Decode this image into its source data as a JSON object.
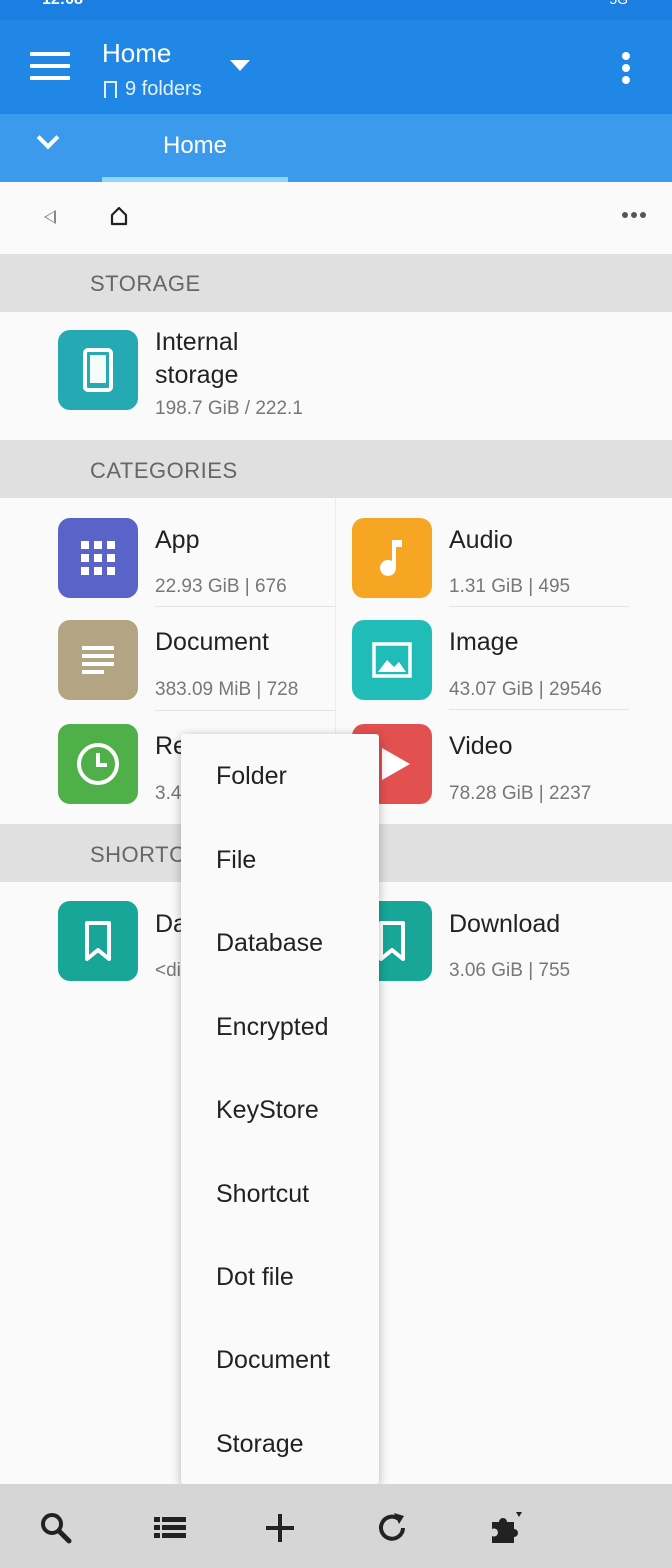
{
  "status_bar": {
    "time": "12:08",
    "right": "5G"
  },
  "app_bar": {
    "title": "Home",
    "subtitle": "9 folders"
  },
  "tabs": [
    {
      "label": "Home"
    }
  ],
  "sections": {
    "storage": "STORAGE",
    "categories": "CATEGORIES",
    "shortcuts": "SHORTC"
  },
  "storage": {
    "title_line1": "Internal",
    "title_line2": "storage",
    "usage": "198.7 GiB / 222.1"
  },
  "categories": [
    {
      "name": "App",
      "meta": "22.93 GiB | 676",
      "color": "#5a64c8",
      "icon": "apps-grid-icon"
    },
    {
      "name": "Audio",
      "meta": "1.31 GiB | 495",
      "color": "#f6a623",
      "icon": "music-note-icon"
    },
    {
      "name": "Document",
      "meta": "383.09 MiB | 728",
      "color": "#b3a584",
      "icon": "document-icon"
    },
    {
      "name": "Image",
      "meta": "43.07 GiB | 29546",
      "color": "#1fbcb8",
      "icon": "image-icon"
    },
    {
      "name": "Re",
      "meta": "3.4",
      "color": "#4fb04a",
      "icon": "clock-icon"
    },
    {
      "name": "Video",
      "meta": "78.28 GiB | 2237",
      "color": "#e35050",
      "icon": "play-icon"
    }
  ],
  "shortcuts": [
    {
      "name": "Da",
      "meta": "<di",
      "color": "#17a697",
      "icon": "bookmark-icon"
    },
    {
      "name": "Download",
      "meta": "3.06 GiB | 755",
      "color": "#17a697",
      "icon": "bookmark-icon"
    }
  ],
  "popup_menu": [
    "Folder",
    "File",
    "Database",
    "Encrypted",
    "KeyStore",
    "Shortcut",
    "Dot file",
    "Document",
    "Storage"
  ],
  "bottom_bar": [
    "search-icon",
    "list-icon",
    "add-icon",
    "refresh-icon",
    "plugin-icon"
  ]
}
